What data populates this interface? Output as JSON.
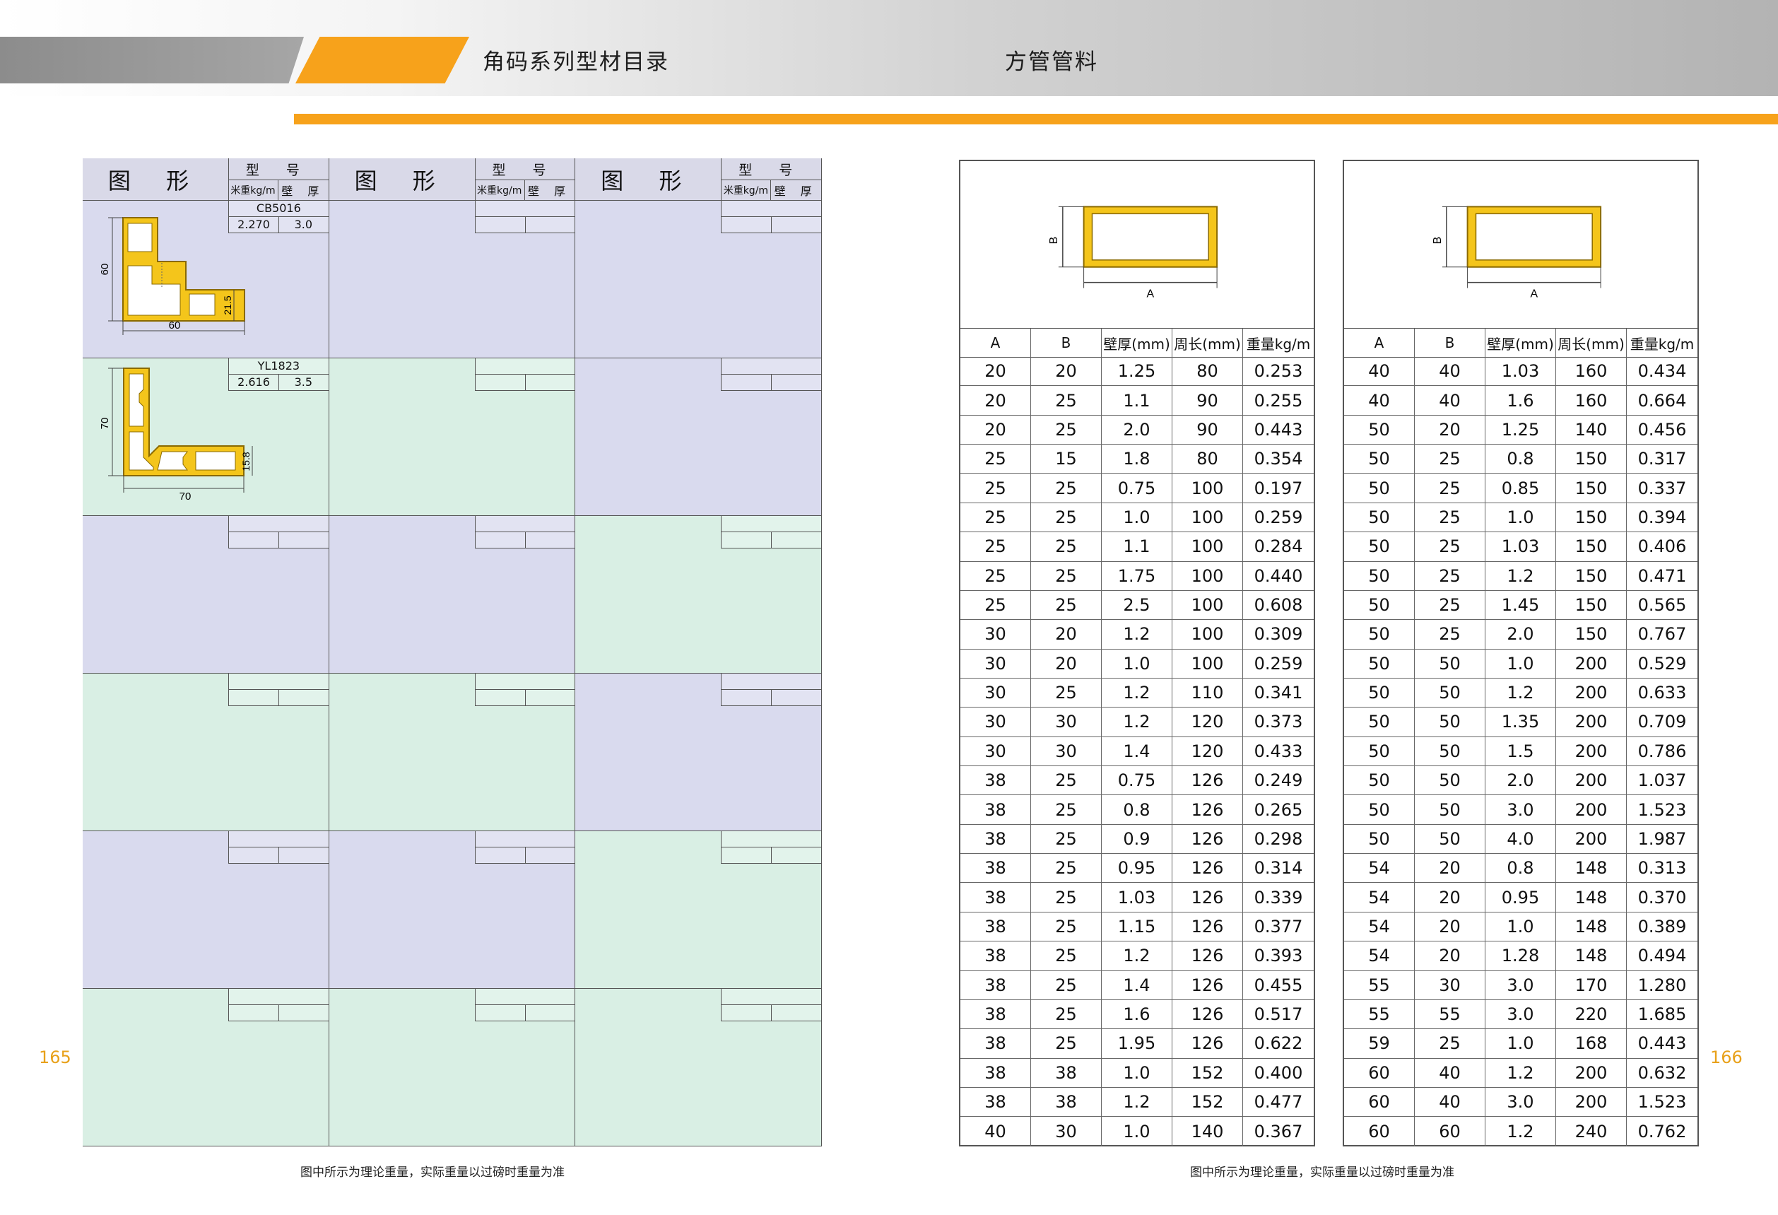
{
  "header": {
    "left_title": "角码系列型材目录",
    "right_title": "方管管料"
  },
  "left_page": {
    "page_number": "165",
    "footnote": "图中所示为理论重量，实际重量以过磅时重量为准",
    "column_header": {
      "title": "图 形",
      "model_label": "型 号",
      "weight_label": "米重kg/m",
      "thickness_label": "壁 厚"
    },
    "profiles": [
      {
        "model": "CB5016",
        "weight": "2.270",
        "thickness": "3.0",
        "dims": [
          "60",
          "60",
          "21.5"
        ]
      },
      {
        "model": "YL1823",
        "weight": "2.616",
        "thickness": "3.5",
        "dims": [
          "70",
          "70",
          "15.8"
        ]
      }
    ]
  },
  "right_page": {
    "page_number": "166",
    "footnote": "图中所示为理论重量，实际重量以过磅时重量为准",
    "diagram_labels": {
      "a": "A",
      "b": "B"
    },
    "columns": [
      "A",
      "B",
      "壁厚(mm)",
      "周长(mm)",
      "重量kg/m"
    ],
    "table1": [
      [
        "20",
        "20",
        "1.25",
        "80",
        "0.253"
      ],
      [
        "20",
        "25",
        "1.1",
        "90",
        "0.255"
      ],
      [
        "20",
        "25",
        "2.0",
        "90",
        "0.443"
      ],
      [
        "25",
        "15",
        "1.8",
        "80",
        "0.354"
      ],
      [
        "25",
        "25",
        "0.75",
        "100",
        "0.197"
      ],
      [
        "25",
        "25",
        "1.0",
        "100",
        "0.259"
      ],
      [
        "25",
        "25",
        "1.1",
        "100",
        "0.284"
      ],
      [
        "25",
        "25",
        "1.75",
        "100",
        "0.440"
      ],
      [
        "25",
        "25",
        "2.5",
        "100",
        "0.608"
      ],
      [
        "30",
        "20",
        "1.2",
        "100",
        "0.309"
      ],
      [
        "30",
        "20",
        "1.0",
        "100",
        "0.259"
      ],
      [
        "30",
        "25",
        "1.2",
        "110",
        "0.341"
      ],
      [
        "30",
        "30",
        "1.2",
        "120",
        "0.373"
      ],
      [
        "30",
        "30",
        "1.4",
        "120",
        "0.433"
      ],
      [
        "38",
        "25",
        "0.75",
        "126",
        "0.249"
      ],
      [
        "38",
        "25",
        "0.8",
        "126",
        "0.265"
      ],
      [
        "38",
        "25",
        "0.9",
        "126",
        "0.298"
      ],
      [
        "38",
        "25",
        "0.95",
        "126",
        "0.314"
      ],
      [
        "38",
        "25",
        "1.03",
        "126",
        "0.339"
      ],
      [
        "38",
        "25",
        "1.15",
        "126",
        "0.377"
      ],
      [
        "38",
        "25",
        "1.2",
        "126",
        "0.393"
      ],
      [
        "38",
        "25",
        "1.4",
        "126",
        "0.455"
      ],
      [
        "38",
        "25",
        "1.6",
        "126",
        "0.517"
      ],
      [
        "38",
        "25",
        "1.95",
        "126",
        "0.622"
      ],
      [
        "38",
        "38",
        "1.0",
        "152",
        "0.400"
      ],
      [
        "38",
        "38",
        "1.2",
        "152",
        "0.477"
      ],
      [
        "40",
        "30",
        "1.0",
        "140",
        "0.367"
      ]
    ],
    "table2": [
      [
        "40",
        "40",
        "1.03",
        "160",
        "0.434"
      ],
      [
        "40",
        "40",
        "1.6",
        "160",
        "0.664"
      ],
      [
        "50",
        "20",
        "1.25",
        "140",
        "0.456"
      ],
      [
        "50",
        "25",
        "0.8",
        "150",
        "0.317"
      ],
      [
        "50",
        "25",
        "0.85",
        "150",
        "0.337"
      ],
      [
        "50",
        "25",
        "1.0",
        "150",
        "0.394"
      ],
      [
        "50",
        "25",
        "1.03",
        "150",
        "0.406"
      ],
      [
        "50",
        "25",
        "1.2",
        "150",
        "0.471"
      ],
      [
        "50",
        "25",
        "1.45",
        "150",
        "0.565"
      ],
      [
        "50",
        "25",
        "2.0",
        "150",
        "0.767"
      ],
      [
        "50",
        "50",
        "1.0",
        "200",
        "0.529"
      ],
      [
        "50",
        "50",
        "1.2",
        "200",
        "0.633"
      ],
      [
        "50",
        "50",
        "1.35",
        "200",
        "0.709"
      ],
      [
        "50",
        "50",
        "1.5",
        "200",
        "0.786"
      ],
      [
        "50",
        "50",
        "2.0",
        "200",
        "1.037"
      ],
      [
        "50",
        "50",
        "3.0",
        "200",
        "1.523"
      ],
      [
        "50",
        "50",
        "4.0",
        "200",
        "1.987"
      ],
      [
        "54",
        "20",
        "0.8",
        "148",
        "0.313"
      ],
      [
        "54",
        "20",
        "0.95",
        "148",
        "0.370"
      ],
      [
        "54",
        "20",
        "1.0",
        "148",
        "0.389"
      ],
      [
        "54",
        "20",
        "1.28",
        "148",
        "0.494"
      ],
      [
        "55",
        "30",
        "3.0",
        "170",
        "1.280"
      ],
      [
        "55",
        "55",
        "3.0",
        "220",
        "1.685"
      ],
      [
        "59",
        "25",
        "1.0",
        "168",
        "0.443"
      ],
      [
        "60",
        "40",
        "1.2",
        "200",
        "0.632"
      ],
      [
        "60",
        "40",
        "3.0",
        "200",
        "1.523"
      ],
      [
        "60",
        "60",
        "1.2",
        "240",
        "0.762"
      ]
    ]
  },
  "colors": {
    "orange": "#f7a21b",
    "profile_yellow": "#f4c51b",
    "cell_blue": "#d9daee",
    "cell_green": "#d9efe4"
  }
}
